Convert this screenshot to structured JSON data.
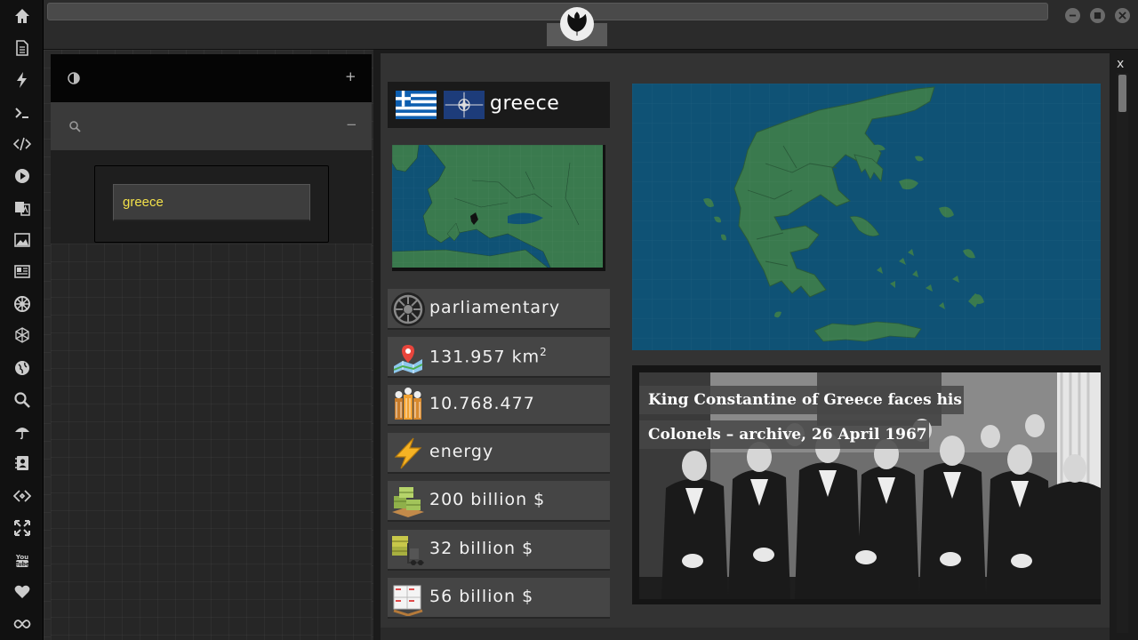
{
  "sidebar": {
    "icons": [
      "home-icon",
      "document-icon",
      "lightning-icon",
      "terminal-icon",
      "code-icon",
      "play-icon",
      "translate-icon",
      "image-icon",
      "newspaper-icon",
      "empire-icon",
      "network-icon",
      "globe-icon",
      "search-icon",
      "umbrella-icon",
      "contacts-icon",
      "code-brackets-icon",
      "expand-icon",
      "youtube-icon",
      "heart-icon",
      "infinity-icon"
    ]
  },
  "left_panel": {
    "row1_icon": "contrast-icon",
    "row1_action": "+",
    "row2_icon": "search-icon",
    "row2_action": "−",
    "search_value": "greece"
  },
  "country": {
    "name": "greece",
    "government": "parliamentary",
    "area": "131.957 km",
    "area_unit_sup": "2",
    "population": "10.768.477",
    "energy": "energy",
    "gdp": "200 billion $",
    "exports": "32 billion $",
    "imports": "56 billion $"
  },
  "news": {
    "title": "King Constantine of Greece faces his Colonels – archive, 26 April 1967"
  },
  "panel": {
    "close_label": "x"
  },
  "colors": {
    "sea": "#0f5275",
    "land": "#3a7a4e",
    "accent_input": "#f2e04a"
  }
}
